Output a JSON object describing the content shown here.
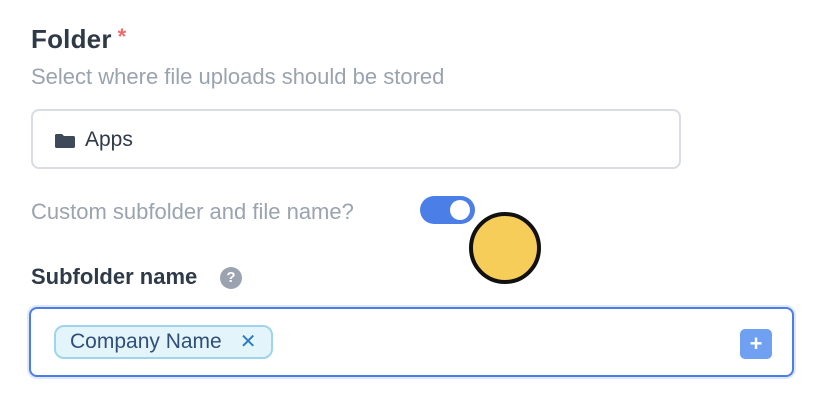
{
  "folder": {
    "label": "Folder",
    "required_mark": "*",
    "description": "Select where file uploads should be stored",
    "selected_value": "Apps",
    "icon": "folder-icon"
  },
  "custom_toggle": {
    "label": "Custom subfolder and file name?",
    "enabled": true
  },
  "subfolder": {
    "label": "Subfolder name",
    "help_glyph": "?",
    "tokens": [
      {
        "label": "Company Name",
        "remove_glyph": "✕"
      }
    ],
    "add_glyph": "+"
  },
  "colors": {
    "accent": "#4c7ee7",
    "required": "#f06a6a",
    "token_bg": "#e4f4fb",
    "marker": "#f6cd58"
  }
}
